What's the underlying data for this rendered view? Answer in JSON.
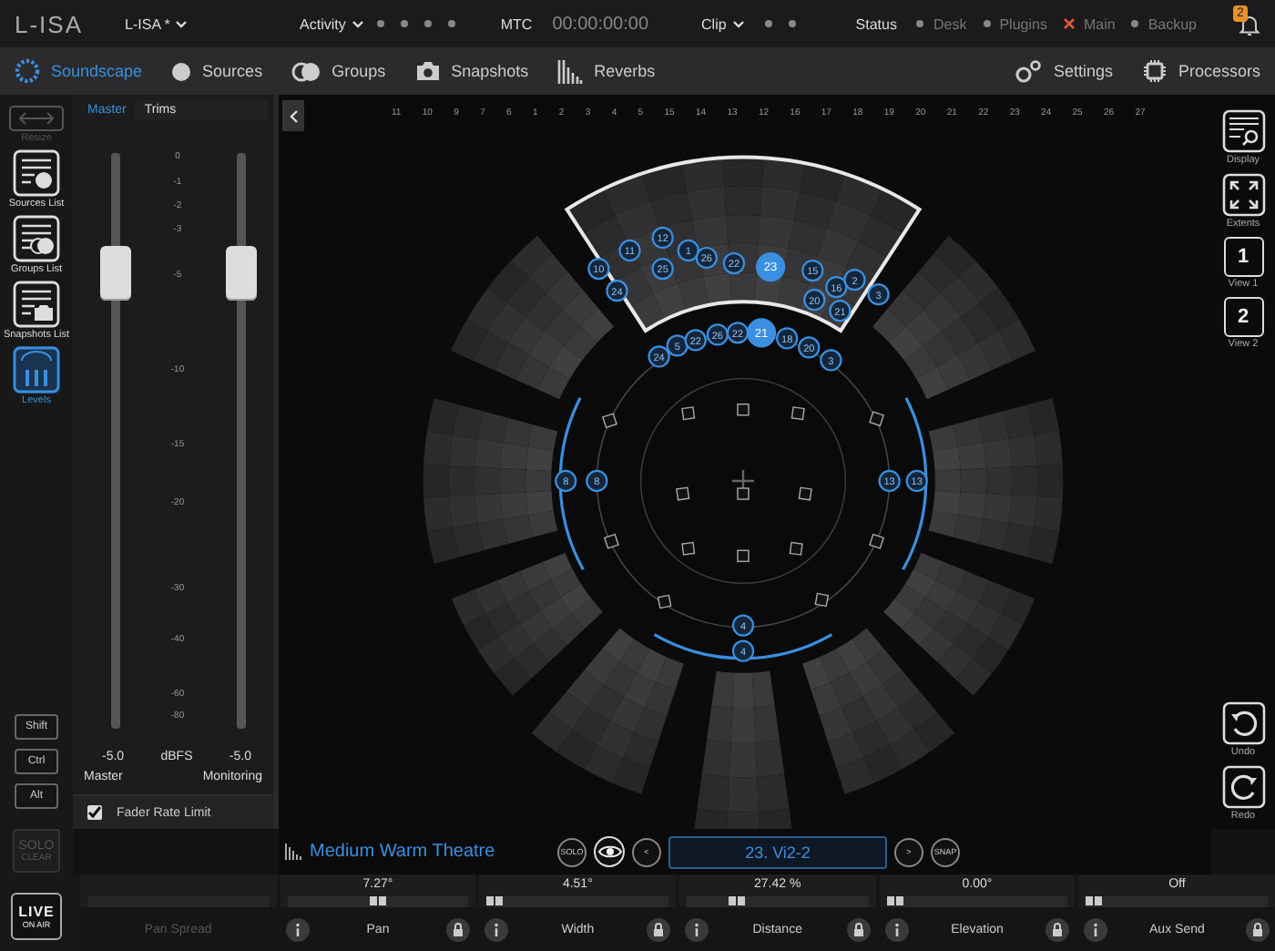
{
  "top_bar": {
    "logo": "L-ISA",
    "project": "L-ISA *",
    "activity": {
      "label": "Activity",
      "indicators": [
        {
          "on": false
        },
        {
          "on": false
        },
        {
          "on": false
        },
        {
          "on": false
        }
      ]
    },
    "mtc": {
      "label": "MTC",
      "time": "00:00:00:00"
    },
    "clip": {
      "label": "Clip",
      "indicators": [
        {
          "on": false
        },
        {
          "on": false
        }
      ]
    },
    "status": {
      "label": "Status",
      "items": [
        {
          "label": "Desk",
          "error": false
        },
        {
          "label": "Plugins",
          "error": false
        },
        {
          "label": "Main",
          "error": true
        },
        {
          "label": "Backup",
          "error": false
        }
      ]
    },
    "notifications": {
      "count": "2"
    }
  },
  "nav": {
    "tabs": [
      {
        "label": "Soundscape",
        "kind": "soundscape",
        "selected": true
      },
      {
        "label": "Sources",
        "kind": "sources",
        "selected": false
      },
      {
        "label": "Groups",
        "kind": "groups",
        "selected": false
      },
      {
        "label": "Snapshots",
        "kind": "snapshots",
        "selected": false
      },
      {
        "label": "Reverbs",
        "kind": "reverbs",
        "selected": false
      }
    ],
    "right": [
      {
        "label": "Settings",
        "kind": "settings"
      },
      {
        "label": "Processors",
        "kind": "processors"
      }
    ]
  },
  "sidebar": {
    "items": [
      {
        "label": "Resize",
        "kind": "resize",
        "selected": false,
        "disabled": true
      },
      {
        "label": "Sources List",
        "kind": "sources",
        "selected": false,
        "disabled": false
      },
      {
        "label": "Groups List",
        "kind": "groups",
        "selected": false,
        "disabled": false
      },
      {
        "label": "Snapshots List",
        "kind": "snapshots",
        "selected": false,
        "disabled": false
      },
      {
        "label": "Levels",
        "kind": "levels",
        "selected": true,
        "disabled": false
      }
    ],
    "modifiers": [
      "Shift",
      "Ctrl",
      "Alt"
    ],
    "solo_clear": {
      "top": "SOLO",
      "bottom": "CLEAR",
      "disabled": true
    },
    "live": {
      "top": "LIVE",
      "bottom": "ON AIR"
    }
  },
  "levels": {
    "tabs": [
      {
        "label": "Master",
        "selected": true
      },
      {
        "label": "Trims",
        "selected": false
      }
    ],
    "scale": [
      "0",
      "-1",
      "-2",
      "-3",
      "-5",
      "-10",
      "-15",
      "-20",
      "-30",
      "-40",
      "-60",
      "-80"
    ],
    "unit": "dBFS",
    "faders": [
      {
        "name": "Master",
        "value": "-5.0",
        "level": 0.79
      },
      {
        "name": "Monitoring",
        "value": "-5.0",
        "level": 0.79
      }
    ],
    "fader_rate_limit": {
      "label": "Fader Rate Limit",
      "checked": true
    }
  },
  "soundscape": {
    "speaker_numbers": [
      "11",
      "10",
      "9",
      "7",
      "6",
      "1",
      "2",
      "3",
      "4",
      "5",
      "15",
      "14",
      "13",
      "12",
      "16",
      "17",
      "18",
      "19",
      "20",
      "21",
      "22",
      "23",
      "24",
      "25",
      "26",
      "27"
    ],
    "sources": [
      {
        "label": "10",
        "selected": false
      },
      {
        "label": "24",
        "selected": false
      },
      {
        "label": "11",
        "selected": false
      },
      {
        "label": "12",
        "selected": false
      },
      {
        "label": "25",
        "selected": false
      },
      {
        "label": "1",
        "selected": false
      },
      {
        "label": "26",
        "selected": false
      },
      {
        "label": "22",
        "selected": false
      },
      {
        "label": "23",
        "selected": true
      },
      {
        "label": "15",
        "selected": false
      },
      {
        "label": "16",
        "selected": false
      },
      {
        "label": "2",
        "selected": false
      },
      {
        "label": "20",
        "selected": false
      },
      {
        "label": "21",
        "selected": false
      },
      {
        "label": "3",
        "selected": false
      },
      {
        "label": "24",
        "selected": false
      },
      {
        "label": "5",
        "selected": false
      },
      {
        "label": "22",
        "selected": false
      },
      {
        "label": "26",
        "selected": false
      },
      {
        "label": "22",
        "selected": false
      },
      {
        "label": "21",
        "selected": true
      },
      {
        "label": "18",
        "selected": false
      },
      {
        "label": "20",
        "selected": false
      },
      {
        "label": "3",
        "selected": false
      },
      {
        "label": "8",
        "selected": false
      },
      {
        "label": "8",
        "selected": false
      },
      {
        "label": "13",
        "selected": false
      },
      {
        "label": "13",
        "selected": false
      },
      {
        "label": "4",
        "selected": false
      },
      {
        "label": "4",
        "selected": false
      }
    ],
    "room": "Medium Warm Theatre",
    "selection": {
      "solo": "SOLO",
      "prev": "<",
      "name": "23. Vi2-2",
      "next": ">",
      "snap": "SNAP"
    }
  },
  "right_toolbar": [
    {
      "label": "Display",
      "kind": "display"
    },
    {
      "label": "Extents",
      "kind": "extents"
    },
    {
      "label": "View 1",
      "kind": "view",
      "number": "1"
    },
    {
      "label": "View 2",
      "kind": "view",
      "number": "2"
    }
  ],
  "history": [
    {
      "label": "Undo",
      "kind": "undo"
    },
    {
      "label": "Redo",
      "kind": "redo"
    }
  ],
  "parameters": [
    {
      "label": "Pan Spread",
      "disabled": true
    },
    {
      "label": "Pan",
      "value": "7.27°",
      "level": 0.5,
      "disabled": false
    },
    {
      "label": "Width",
      "value": "4.51°",
      "level": 0,
      "disabled": false
    },
    {
      "label": "Distance",
      "value": "27.42 %",
      "level": 0.25,
      "disabled": false
    },
    {
      "label": "Elevation",
      "value": "0.00°",
      "level": 0,
      "disabled": false
    },
    {
      "label": "Aux Send",
      "value": "Off",
      "level": 0,
      "disabled": false
    }
  ]
}
